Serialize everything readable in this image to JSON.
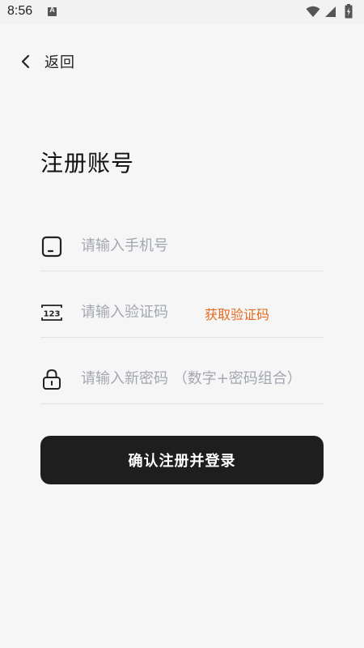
{
  "status_bar": {
    "time": "8:56",
    "notification_letter": "A",
    "icons": [
      "wifi-icon",
      "signal-icon",
      "battery-icon"
    ]
  },
  "nav": {
    "back_label": "返回",
    "back_icon": "chevron-left-icon"
  },
  "page": {
    "title": "注册账号"
  },
  "form": {
    "phone": {
      "placeholder": "请输入手机号",
      "value": "",
      "icon": "phone-icon"
    },
    "code": {
      "placeholder": "请输入验证码",
      "value": "",
      "icon": "number-code-icon",
      "icon_text": "123",
      "get_code_label": "获取验证码"
    },
    "password": {
      "placeholder": "请输入新密码 （数字+密码组合）",
      "value": "",
      "icon": "lock-icon"
    },
    "submit_label": "确认注册并登录"
  },
  "colors": {
    "background": "#f6f6f6",
    "accent": "#e46a1f",
    "button_bg": "#1e1e1e",
    "button_text": "#ffffff",
    "placeholder": "#a3a7b0",
    "divider": "#dfe2ea"
  }
}
